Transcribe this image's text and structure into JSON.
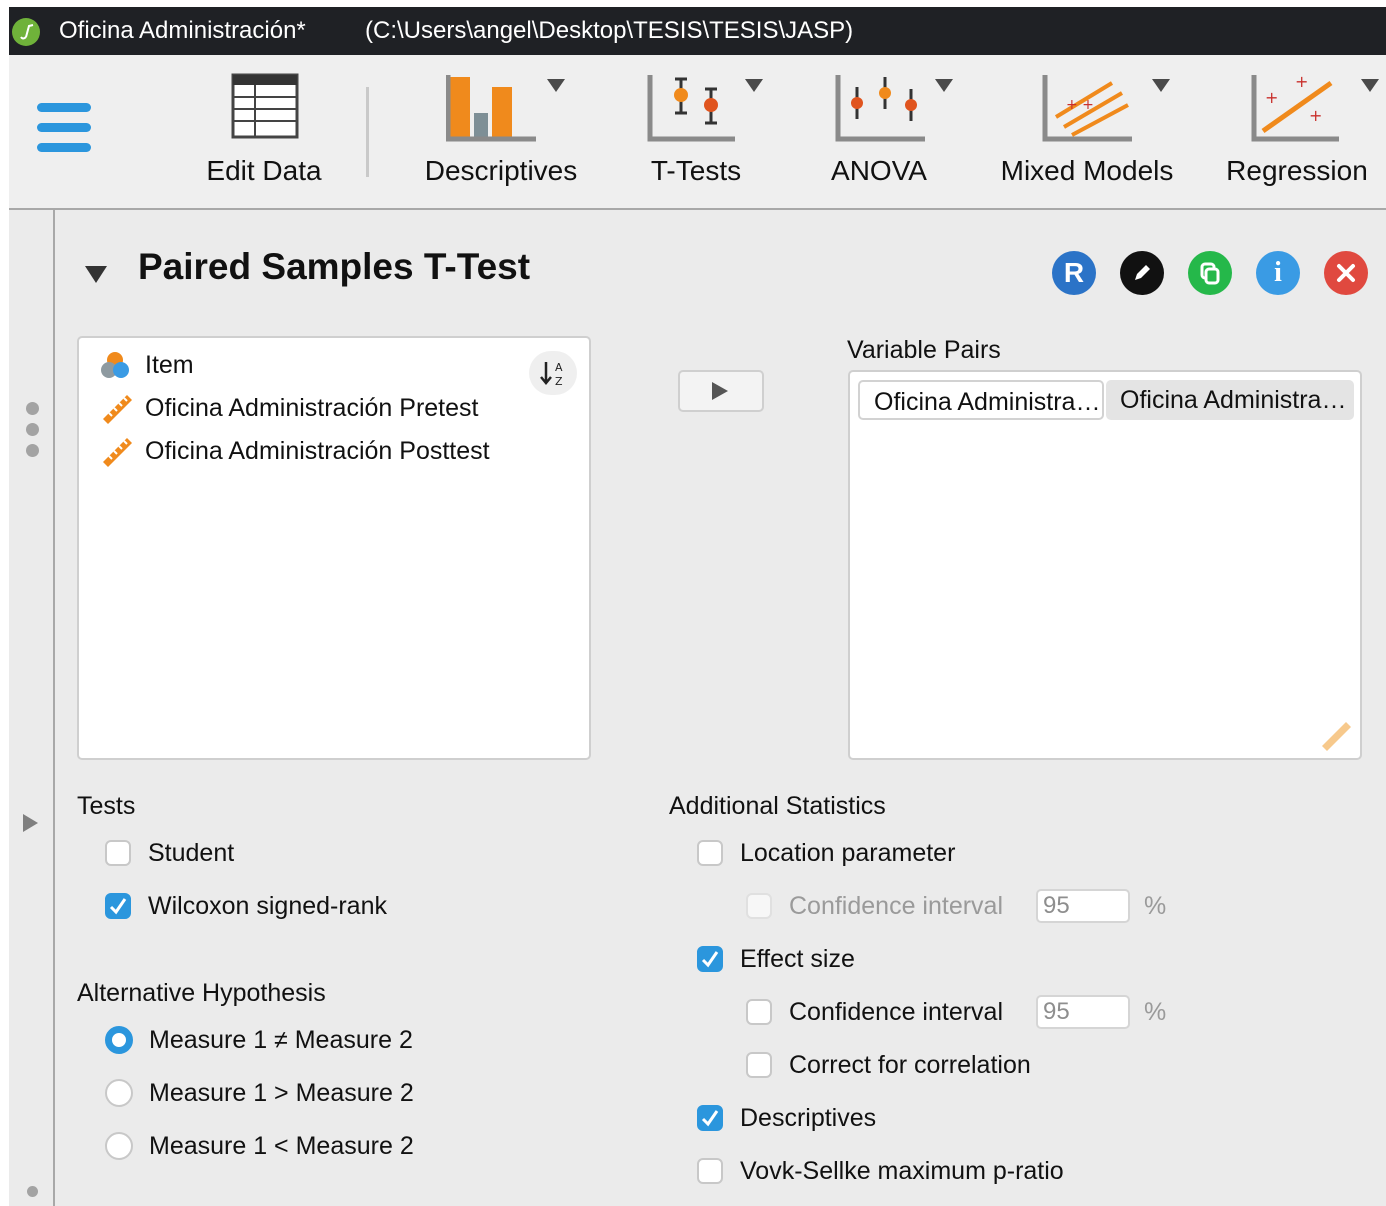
{
  "window": {
    "title": "Oficina Administración*",
    "path": "(C:\\Users\\angel\\Desktop\\TESIS\\TESIS\\JASP)"
  },
  "ribbon": {
    "edit_data": "Edit Data",
    "descriptives": "Descriptives",
    "t_tests": "T-Tests",
    "anova": "ANOVA",
    "mixed_models": "Mixed Models",
    "regression": "Regression"
  },
  "analysis": {
    "title": "Paired Samples T-Test",
    "header_buttons": [
      "r-syntax-icon",
      "edit-pencil-icon",
      "duplicate-icon",
      "info-icon",
      "close-icon"
    ]
  },
  "variables": {
    "items": [
      "Item",
      "Oficina Administración Pretest",
      "Oficina Administración Posttest"
    ]
  },
  "pairs": {
    "label": "Variable Pairs",
    "first": "Oficina Administración Pretest",
    "second": "Oficina Administración Posttest"
  },
  "tests": {
    "label": "Tests",
    "student": "Student",
    "wilcoxon": "Wilcoxon signed-rank"
  },
  "hypothesis": {
    "label": "Alternative Hypothesis",
    "options": [
      "Measure 1 ≠ Measure 2",
      "Measure 1 > Measure 2",
      "Measure 1 < Measure 2"
    ]
  },
  "additional": {
    "label": "Additional Statistics",
    "location_parameter": "Location parameter",
    "confidence_interval": "Confidence interval",
    "ci_value_1": "95",
    "percent": "%",
    "effect_size": "Effect size",
    "ci_value_2": "95",
    "correct_for_correlation": "Correct for correlation",
    "descriptives": "Descriptives",
    "vovk_sellke": "Vovk-Sellke maximum p-ratio"
  },
  "colors": {
    "accent": "#2b96dd",
    "titlebar": "#1f2125",
    "panel": "#ebebeb",
    "ordinal_icon": "#f08a1c"
  }
}
